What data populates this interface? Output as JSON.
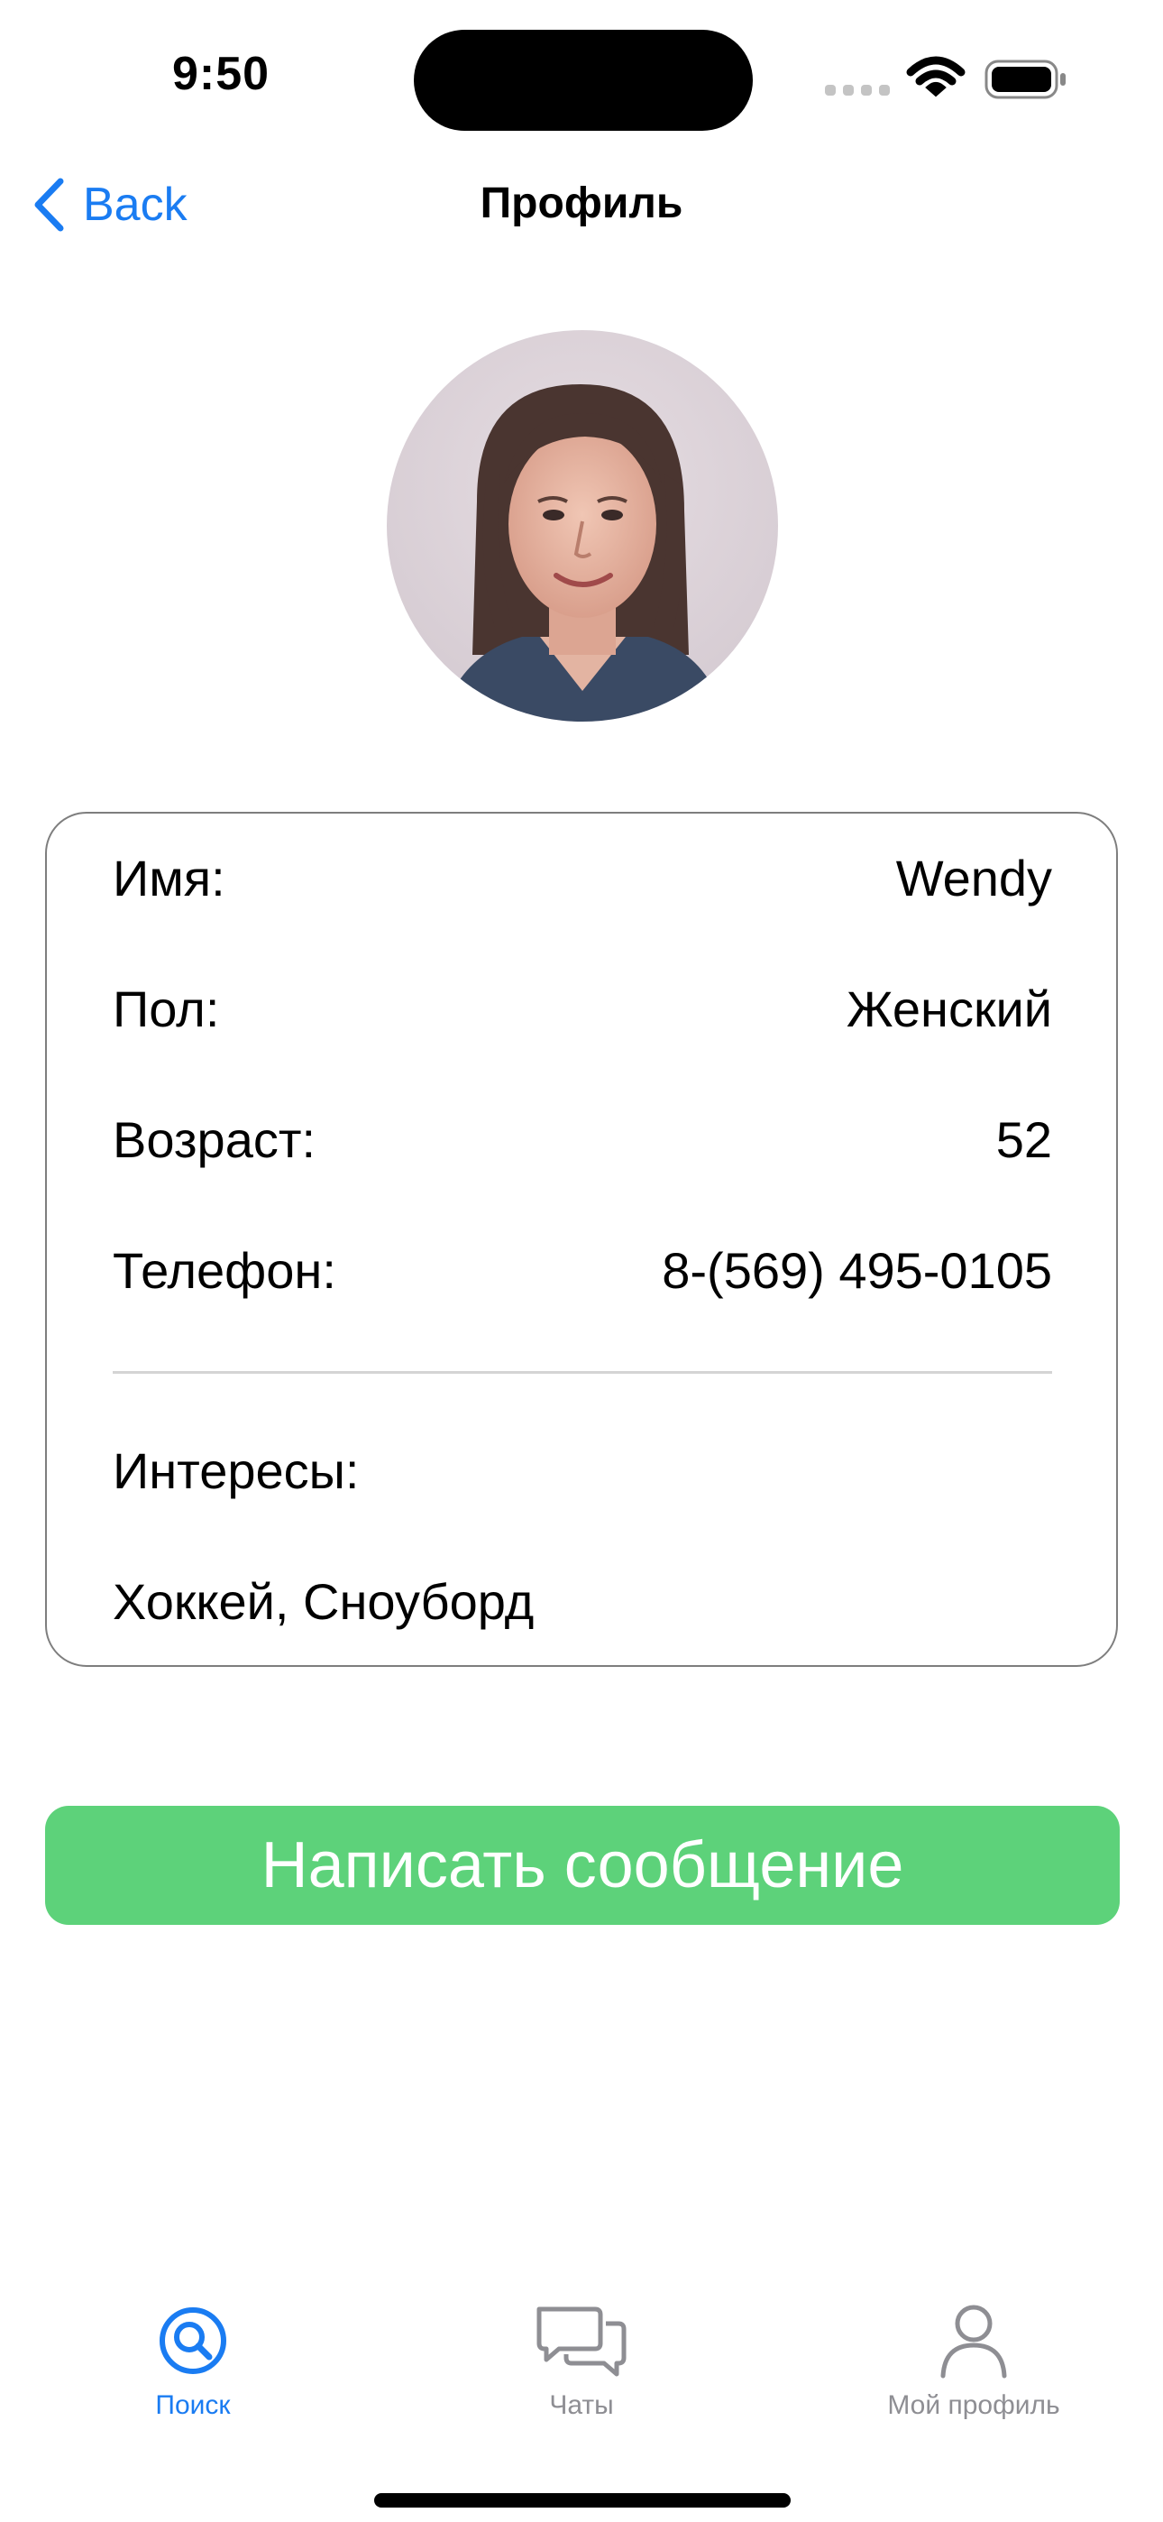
{
  "status_bar": {
    "time": "9:50",
    "icons": [
      "cellular-signal-icon",
      "wifi-icon",
      "battery-icon"
    ]
  },
  "nav": {
    "back_label": "Back",
    "title": "Профиль"
  },
  "avatar": {
    "icon": "profile-photo"
  },
  "profile": {
    "rows": [
      {
        "label": "Имя:",
        "value": "Wendy"
      },
      {
        "label": "Пол:",
        "value": "Женский"
      },
      {
        "label": "Возраст:",
        "value": "52"
      },
      {
        "label": "Телефон:",
        "value": "8-(569) 495-0105"
      }
    ],
    "interests_label": "Интересы:",
    "interests_value": "Хоккей, Сноуборд"
  },
  "action": {
    "message_button_label": "Написать сообщение"
  },
  "tab_bar": {
    "tabs": [
      {
        "label": "Поиск",
        "icon": "search-icon",
        "active": true
      },
      {
        "label": "Чаты",
        "icon": "chat-bubbles-icon",
        "active": false
      },
      {
        "label": "Мой профиль",
        "icon": "person-icon",
        "active": false
      }
    ]
  },
  "colors": {
    "accent": "#1a7cf2",
    "button": "#5dd27a",
    "inactive_tab": "#8e8e93",
    "card_border": "#7e7e7e"
  }
}
